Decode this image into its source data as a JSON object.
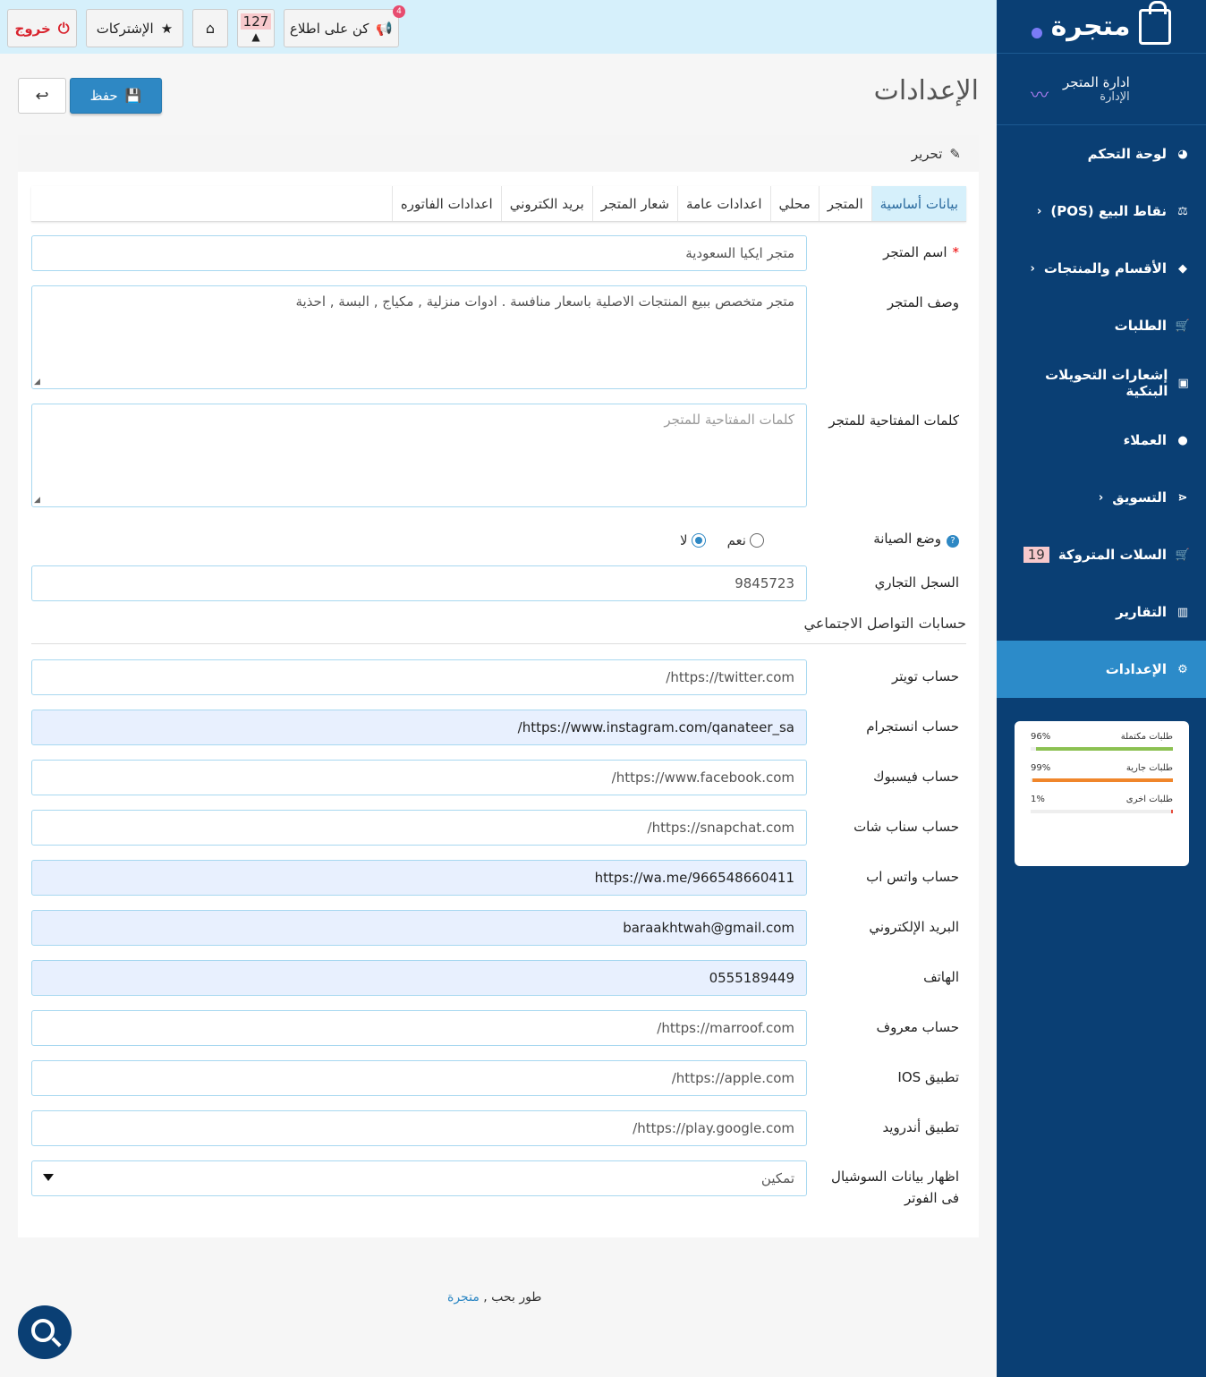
{
  "sidebar": {
    "brand": "متجرة",
    "store_title": "ادارة المتجر",
    "store_sub": "الإدارة",
    "items": [
      {
        "label": "لوحة التحكم",
        "icon": "dashboard-icon",
        "glyph": "◕"
      },
      {
        "label": "نقاط البيع (POS)",
        "icon": "balance-scale-icon",
        "glyph": "⚖",
        "arrow": "‹"
      },
      {
        "label": "الأقسام والمنتجات",
        "icon": "tag-icon",
        "glyph": "◆",
        "arrow": "‹"
      },
      {
        "label": "الطلبات",
        "icon": "cart-icon",
        "glyph": "🛒"
      },
      {
        "label": "إشعارات التحويلات البنكية",
        "icon": "money-icon",
        "glyph": "▣"
      },
      {
        "label": "العملاء",
        "icon": "user-icon",
        "glyph": "●"
      },
      {
        "label": "التسويق",
        "icon": "share-icon",
        "glyph": "⋖",
        "arrow": "‹"
      },
      {
        "label": "السلات المتروكة",
        "icon": "cart-icon",
        "glyph": "🛒",
        "badge": "19"
      },
      {
        "label": "التقارير",
        "icon": "bar-chart-icon",
        "glyph": "▥"
      },
      {
        "label": "الإعدادات",
        "icon": "gear-icon",
        "glyph": "⚙",
        "active": true
      }
    ],
    "stats": [
      {
        "label": "طلبات مكتملة",
        "value": "96%",
        "fraction": 0.96,
        "color": "#8cc152"
      },
      {
        "label": "طلبات جارية",
        "value": "99%",
        "fraction": 0.99,
        "color": "#f0862b"
      },
      {
        "label": "طلبات اخرى",
        "value": "1%",
        "fraction": 0.01,
        "color": "#e74c3c"
      }
    ]
  },
  "topbar": {
    "logout": "خروج",
    "subscriptions": "الإشتركات",
    "count": "127",
    "stay_informed": "كن على اطلاع",
    "notif_badge": "4"
  },
  "page": {
    "title": "الإعدادات",
    "save": "حفظ",
    "panel_title": "تحرير"
  },
  "tabs": [
    "بيانات أساسية",
    "المتجر",
    "محلي",
    "اعدادات عامة",
    "شعار المتجر",
    "بريد الكتروني",
    "اعدادات الفاتوره"
  ],
  "form": {
    "store_name_label": "اسم المتجر",
    "store_name_value": "متجر ايكيا السعودية",
    "desc_label": "وصف المتجر",
    "desc_value": "متجر متخصص ببيع المنتجات الاصلية باسعار منافسة  . ادوات منزلية , مكياج , البسة , احذية",
    "keywords_label": "كلمات المفتاحية للمتجر",
    "keywords_placeholder": "كلمات المفتاحية للمتجر",
    "maintenance_label": "وضع الصيانة",
    "yes": "نعم",
    "no": "لا",
    "cr_label": "السجل التجاري",
    "cr_value": "9845723",
    "social_title": "حسابات التواصل الاجتماعي",
    "social": [
      {
        "label": "حساب تويتر",
        "value": "https://twitter.com/",
        "filled": false
      },
      {
        "label": "حساب انستجرام",
        "value": "https://www.instagram.com/qanateer_sa/",
        "filled": true
      },
      {
        "label": "حساب فيسبوك",
        "value": "https://www.facebook.com/",
        "filled": false
      },
      {
        "label": "حساب سناب شات",
        "value": "https://snapchat.com/",
        "filled": false
      },
      {
        "label": "حساب واتس اب",
        "value": "https://wa.me/966548660411",
        "filled": true
      },
      {
        "label": "البريد الإلكتروني",
        "value": "baraakhtwah@gmail.com",
        "filled": true
      },
      {
        "label": "الهاتف",
        "value": "0555189449",
        "filled": true
      },
      {
        "label": "حساب معروف",
        "value": "https://marroof.com/",
        "filled": false
      },
      {
        "label": "تطبيق IOS",
        "value": "https://apple.com/",
        "filled": false
      },
      {
        "label": "تطبيق أندرويد",
        "value": "https://play.google.com/",
        "filled": false
      }
    ],
    "footer_social_label": "اظهار بيانات السوشيال فى الفوتر",
    "footer_social_value": "تمكين"
  },
  "footer": {
    "text": "طور بحب ,",
    "link": "متجرة"
  }
}
